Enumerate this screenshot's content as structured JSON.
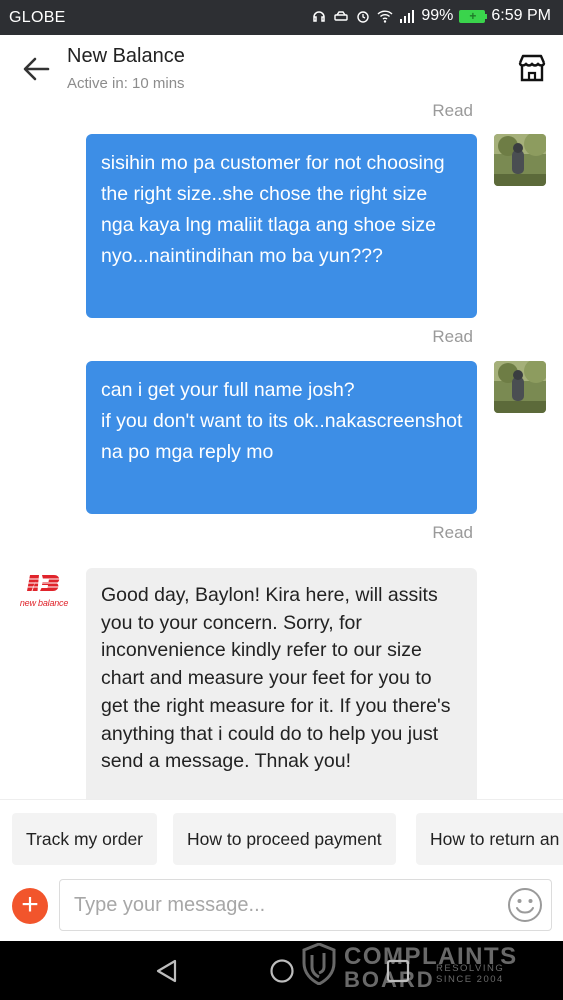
{
  "status_bar": {
    "carrier": "GLOBE",
    "battery_percent": "99%",
    "time": "6:59 PM"
  },
  "header": {
    "title": "New Balance",
    "subtitle": "Active in: 10 mins"
  },
  "messages": [
    {
      "sender": "user",
      "status": "Read",
      "text": "sisihin mo pa customer for not choosing the right size..she chose the right size nga kaya lng maliit tlaga ang shoe size nyo...naintindihan mo ba yun???"
    },
    {
      "sender": "user",
      "status": "Read",
      "text": "can i get your full name josh?\nif you don't want to its ok..nakascreenshot na po mga reply mo"
    },
    {
      "sender": "seller",
      "status": "Read",
      "logo_text": "new balance",
      "text": "Good day, Baylon! Kira here, will assits you to your concern. Sorry, for inconvenience kindly refer to our size chart and measure your feet for you to get the right  measure for it. If you there's anything that i could do to help you just send a message. Thnak you!"
    }
  ],
  "read_labels": [
    "Read",
    "Read",
    "Read"
  ],
  "quick_replies": [
    "Track my order",
    "How to proceed payment",
    "How to return an"
  ],
  "input": {
    "placeholder": "Type your message..."
  },
  "watermark": {
    "line1": "COMPLAINTS",
    "line2": "BOARD",
    "line3": "RESOLVING",
    "line4": "SINCE 2004"
  },
  "colors": {
    "status_bar": "#2d2f33",
    "outgoing_bubble": "#3d8ee6",
    "incoming_bubble": "#efefef",
    "plus_button": "#f2552c",
    "brand_red": "#e0242b"
  }
}
